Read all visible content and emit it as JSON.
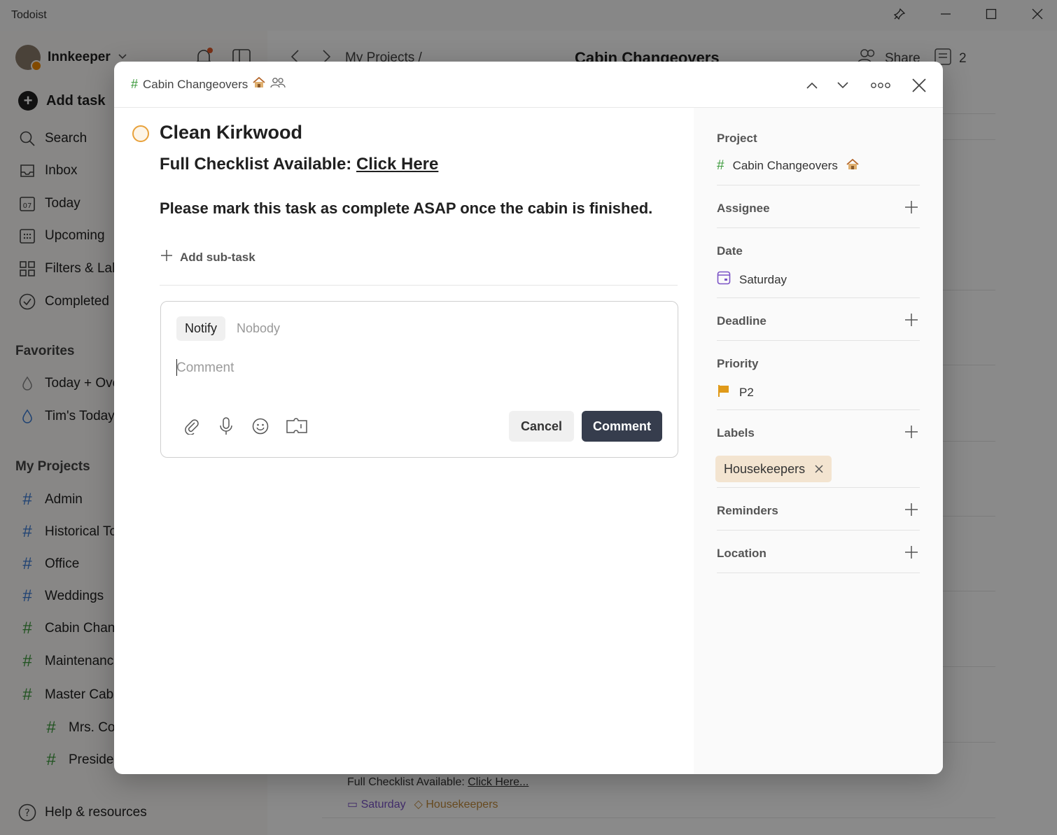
{
  "window": {
    "title": "Todoist"
  },
  "sidebar": {
    "user": "Innkeeper",
    "add_task": "Add task",
    "nav": [
      "Search",
      "Inbox",
      "Today",
      "Upcoming",
      "Filters & Lab",
      "Completed"
    ],
    "today_day": "07",
    "favorites_title": "Favorites",
    "favorites": [
      "Today + Ove",
      "Tim's Today"
    ],
    "projects_title": "My Projects",
    "projects": [
      "Admin",
      "Historical To",
      "Office",
      "Weddings",
      "Cabin Chang",
      "Maintenanc",
      "Master Cabi",
      "Mrs. Co",
      "Presider"
    ],
    "help": "Help & resources"
  },
  "main": {
    "breadcrumb": "My Projects /",
    "title": "Cabin Changeovers",
    "share": "Share",
    "comments_count": "2",
    "bg_task_desc": "Full Checklist Available: ",
    "bg_task_link": "Click Here...",
    "bg_task_date": "Saturday",
    "bg_task_label": "Housekeepers"
  },
  "modal": {
    "project_crumb": "Cabin Changeovers",
    "task_title": "Clean Kirkwood",
    "desc_line1_prefix": "Full Checklist Available: ",
    "desc_line1_link": "Click Here",
    "desc_line2": "Please mark this task as complete ASAP once the cabin is finished.",
    "add_subtask": "Add sub-task",
    "comment": {
      "notify": "Notify",
      "notify_value": "Nobody",
      "placeholder": "Comment",
      "cancel": "Cancel",
      "submit": "Comment"
    },
    "details": {
      "project_label": "Project",
      "project_value": "Cabin Changeovers",
      "assignee_label": "Assignee",
      "date_label": "Date",
      "date_value": "Saturday",
      "deadline_label": "Deadline",
      "priority_label": "Priority",
      "priority_value": "P2",
      "labels_label": "Labels",
      "label_chip": "Housekeepers",
      "reminders_label": "Reminders",
      "location_label": "Location"
    }
  },
  "colors": {
    "accent_dark": "#363d4d",
    "priority_p2": "#e09a1a",
    "date_purple": "#7b53c6",
    "label_chip_bg": "#f3e4d0",
    "project_hash_green": "#3c9a3c"
  }
}
